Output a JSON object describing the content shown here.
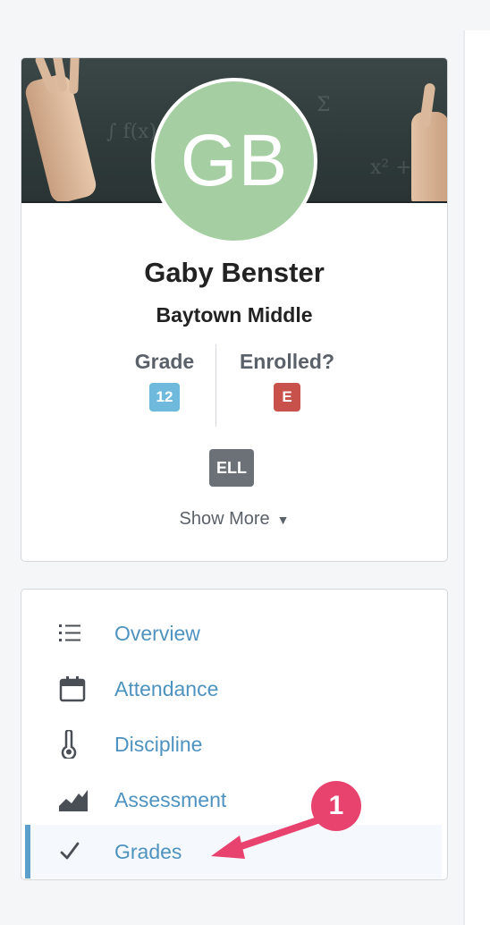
{
  "profile": {
    "initials": "GB",
    "name": "Gaby Benster",
    "school": "Baytown Middle",
    "grade_label": "Grade",
    "grade_value": "12",
    "enrolled_label": "Enrolled?",
    "enrolled_value": "E",
    "tag": "ELL",
    "show_more": "Show More",
    "show_more_caret": "▼",
    "avatar_color": "#a5cfa2"
  },
  "nav": {
    "items": [
      {
        "label": "Overview",
        "icon": "list-icon"
      },
      {
        "label": "Attendance",
        "icon": "calendar-icon"
      },
      {
        "label": "Discipline",
        "icon": "thermometer-icon"
      },
      {
        "label": "Assessment",
        "icon": "area-chart-icon"
      },
      {
        "label": "Grades",
        "icon": "checkmark-icon",
        "active": true
      }
    ],
    "link_color": "#4e93c0",
    "active_color": "#5b9fcb"
  },
  "annotation": {
    "callout_number": "1",
    "color": "#e8436f"
  }
}
